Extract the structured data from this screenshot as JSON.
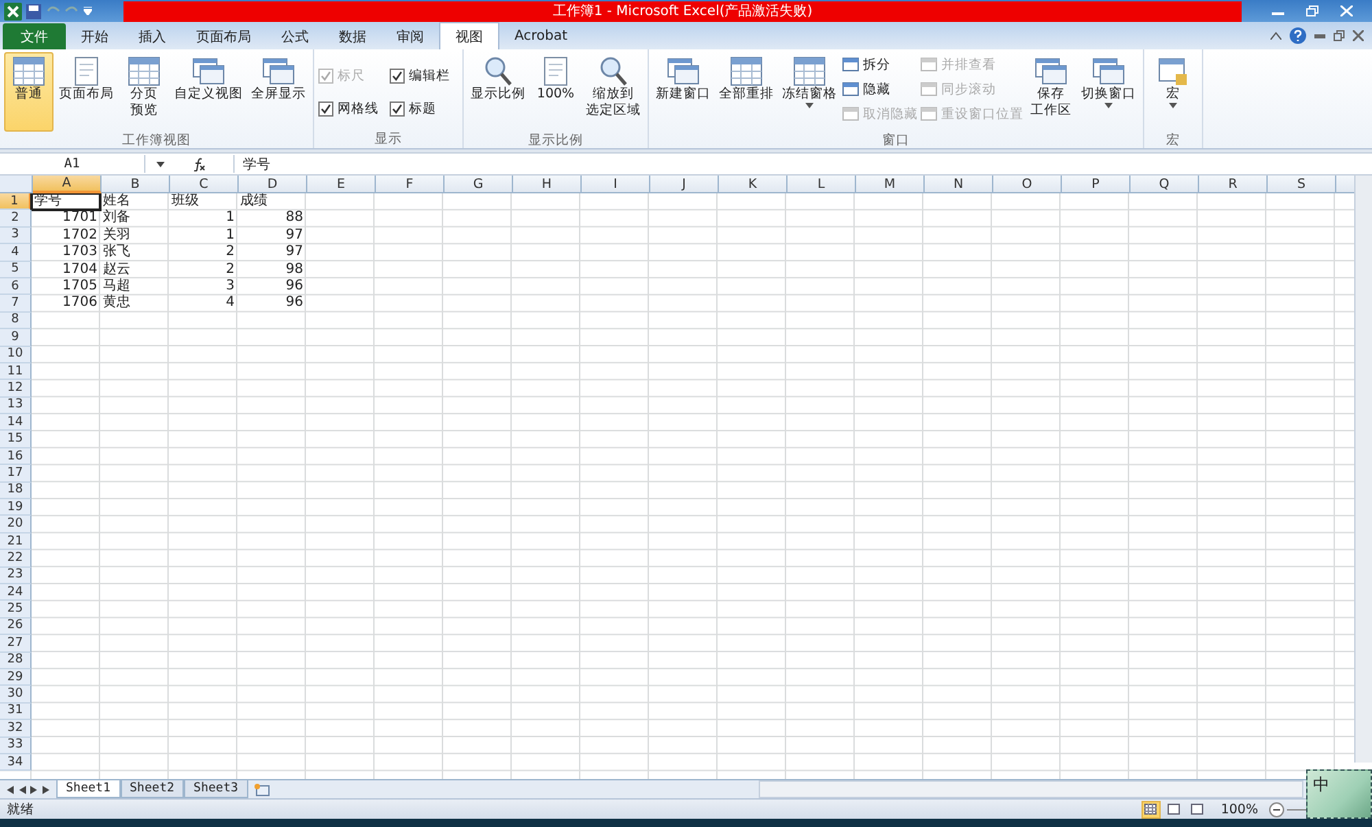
{
  "window": {
    "title": "工作簿1  -  Microsoft Excel(产品激活失败)"
  },
  "ribbon_tabs": [
    {
      "label": "文件",
      "kind": "file",
      "selected": false
    },
    {
      "label": "开始",
      "kind": "tab",
      "selected": false
    },
    {
      "label": "插入",
      "kind": "tab",
      "selected": false
    },
    {
      "label": "页面布局",
      "kind": "tab",
      "selected": false
    },
    {
      "label": "公式",
      "kind": "tab",
      "selected": false
    },
    {
      "label": "数据",
      "kind": "tab",
      "selected": false
    },
    {
      "label": "审阅",
      "kind": "tab",
      "selected": false
    },
    {
      "label": "视图",
      "kind": "tab",
      "selected": true
    },
    {
      "label": "Acrobat",
      "kind": "tab",
      "selected": false
    }
  ],
  "ribbon_groups": [
    {
      "label": "工作簿视图",
      "columns": [
        [
          {
            "kind": "large",
            "label": "普通",
            "selected": true
          }
        ],
        [
          {
            "kind": "large",
            "label": "页面布局",
            "selected": false
          }
        ],
        [
          {
            "kind": "large",
            "label": [
              "分页",
              "预览"
            ],
            "selected": false
          }
        ],
        [
          {
            "kind": "large",
            "label": "自定义视图",
            "selected": false
          }
        ],
        [
          {
            "kind": "large",
            "label": "全屏显示",
            "selected": false
          }
        ]
      ]
    },
    {
      "label": "显示",
      "columns": [
        [
          {
            "kind": "check",
            "label": "标尺",
            "checked": true,
            "disabled": true
          },
          {
            "kind": "check",
            "label": "网格线",
            "checked": true,
            "disabled": false
          }
        ],
        [
          {
            "kind": "check",
            "label": "编辑栏",
            "checked": true,
            "disabled": false
          },
          {
            "kind": "check",
            "label": "标题",
            "checked": true,
            "disabled": false
          }
        ]
      ]
    },
    {
      "label": "显示比例",
      "columns": [
        [
          {
            "kind": "large",
            "label": "显示比例",
            "selected": false
          }
        ],
        [
          {
            "kind": "large",
            "label": "100%",
            "selected": false
          }
        ],
        [
          {
            "kind": "large",
            "label": [
              "缩放到",
              "选定区域"
            ],
            "selected": false
          }
        ]
      ]
    },
    {
      "label": "窗口",
      "columns": [
        [
          {
            "kind": "large",
            "label": "新建窗口",
            "selected": false
          }
        ],
        [
          {
            "kind": "large",
            "label": "全部重排",
            "selected": false
          }
        ],
        [
          {
            "kind": "large",
            "label": "冻结窗格",
            "selected": false,
            "dropdown": true
          }
        ],
        [
          {
            "kind": "small",
            "label": "拆分",
            "disabled": false
          },
          {
            "kind": "small",
            "label": "隐藏",
            "disabled": false
          },
          {
            "kind": "small",
            "label": "取消隐藏",
            "disabled": true
          }
        ],
        [
          {
            "kind": "small",
            "label": "并排查看",
            "disabled": true
          },
          {
            "kind": "small",
            "label": "同步滚动",
            "disabled": true
          },
          {
            "kind": "small",
            "label": "重设窗口位置",
            "disabled": true
          }
        ],
        [
          {
            "kind": "large",
            "label": [
              "保存",
              "工作区"
            ],
            "selected": false
          }
        ],
        [
          {
            "kind": "large",
            "label": "切换窗口",
            "selected": false,
            "dropdown": true
          }
        ]
      ]
    },
    {
      "label": "宏",
      "columns": [
        [
          {
            "kind": "large",
            "label": "宏",
            "selected": false,
            "dropdown": true
          }
        ]
      ]
    }
  ],
  "formula_bar": {
    "name_box": "A1",
    "formula": "学号"
  },
  "columns": [
    {
      "label": "A",
      "selected": true
    },
    {
      "label": "B",
      "selected": false
    },
    {
      "label": "C",
      "selected": false
    },
    {
      "label": "D",
      "selected": false
    },
    {
      "label": "E",
      "selected": false
    },
    {
      "label": "F",
      "selected": false
    },
    {
      "label": "G",
      "selected": false
    },
    {
      "label": "H",
      "selected": false
    },
    {
      "label": "I",
      "selected": false
    },
    {
      "label": "J",
      "selected": false
    },
    {
      "label": "K",
      "selected": false
    },
    {
      "label": "L",
      "selected": false
    },
    {
      "label": "M",
      "selected": false
    },
    {
      "label": "N",
      "selected": false
    },
    {
      "label": "O",
      "selected": false
    },
    {
      "label": "P",
      "selected": false
    },
    {
      "label": "Q",
      "selected": false
    },
    {
      "label": "R",
      "selected": false
    },
    {
      "label": "S",
      "selected": false
    }
  ],
  "rows": [
    {
      "label": "1",
      "selected": true,
      "cells": [
        {
          "text": "学号",
          "kind": "text",
          "selected": true
        },
        {
          "text": "姓名",
          "kind": "text",
          "selected": false
        },
        {
          "text": "班级",
          "kind": "text",
          "selected": false
        },
        {
          "text": "成绩",
          "kind": "text",
          "selected": false
        }
      ]
    },
    {
      "label": "2",
      "selected": false,
      "cells": [
        {
          "text": "1701",
          "kind": "number",
          "selected": false
        },
        {
          "text": "刘备",
          "kind": "text",
          "selected": false
        },
        {
          "text": "1",
          "kind": "number",
          "selected": false
        },
        {
          "text": "88",
          "kind": "number",
          "selected": false
        }
      ]
    },
    {
      "label": "3",
      "selected": false,
      "cells": [
        {
          "text": "1702",
          "kind": "number",
          "selected": false
        },
        {
          "text": "关羽",
          "kind": "text",
          "selected": false
        },
        {
          "text": "1",
          "kind": "number",
          "selected": false
        },
        {
          "text": "97",
          "kind": "number",
          "selected": false
        }
      ]
    },
    {
      "label": "4",
      "selected": false,
      "cells": [
        {
          "text": "1703",
          "kind": "number",
          "selected": false
        },
        {
          "text": "张飞",
          "kind": "text",
          "selected": false
        },
        {
          "text": "2",
          "kind": "number",
          "selected": false
        },
        {
          "text": "97",
          "kind": "number",
          "selected": false
        }
      ]
    },
    {
      "label": "5",
      "selected": false,
      "cells": [
        {
          "text": "1704",
          "kind": "number",
          "selected": false
        },
        {
          "text": "赵云",
          "kind": "text",
          "selected": false
        },
        {
          "text": "2",
          "kind": "number",
          "selected": false
        },
        {
          "text": "98",
          "kind": "number",
          "selected": false
        }
      ]
    },
    {
      "label": "6",
      "selected": false,
      "cells": [
        {
          "text": "1705",
          "kind": "number",
          "selected": false
        },
        {
          "text": "马超",
          "kind": "text",
          "selected": false
        },
        {
          "text": "3",
          "kind": "number",
          "selected": false
        },
        {
          "text": "96",
          "kind": "number",
          "selected": false
        }
      ]
    },
    {
      "label": "7",
      "selected": false,
      "cells": [
        {
          "text": "1706",
          "kind": "number",
          "selected": false
        },
        {
          "text": "黄忠",
          "kind": "text",
          "selected": false
        },
        {
          "text": "4",
          "kind": "number",
          "selected": false
        },
        {
          "text": "96",
          "kind": "number",
          "selected": false
        }
      ]
    },
    {
      "label": "8",
      "selected": false
    },
    {
      "label": "9",
      "selected": false
    },
    {
      "label": "10",
      "selected": false
    },
    {
      "label": "11",
      "selected": false
    },
    {
      "label": "12",
      "selected": false
    },
    {
      "label": "13",
      "selected": false
    },
    {
      "label": "14",
      "selected": false
    },
    {
      "label": "15",
      "selected": false
    },
    {
      "label": "16",
      "selected": false
    },
    {
      "label": "17",
      "selected": false
    },
    {
      "label": "18",
      "selected": false
    },
    {
      "label": "19",
      "selected": false
    },
    {
      "label": "20",
      "selected": false
    },
    {
      "label": "21",
      "selected": false
    },
    {
      "label": "22",
      "selected": false
    },
    {
      "label": "23",
      "selected": false
    },
    {
      "label": "24",
      "selected": false
    },
    {
      "label": "25",
      "selected": false
    },
    {
      "label": "26",
      "selected": false
    },
    {
      "label": "27",
      "selected": false
    },
    {
      "label": "28",
      "selected": false
    },
    {
      "label": "29",
      "selected": false
    },
    {
      "label": "30",
      "selected": false
    },
    {
      "label": "31",
      "selected": false
    },
    {
      "label": "32",
      "selected": false
    },
    {
      "label": "33",
      "selected": false
    },
    {
      "label": "34",
      "selected": false
    }
  ],
  "sheets": [
    {
      "label": "Sheet1",
      "selected": true
    },
    {
      "label": "Sheet2",
      "selected": false
    },
    {
      "label": "Sheet3",
      "selected": false
    }
  ],
  "status_bar": {
    "status": "就绪",
    "views": [
      {
        "selected": true
      },
      {
        "selected": false
      },
      {
        "selected": false
      }
    ],
    "zoom": "100%"
  },
  "ime": {
    "label": "中"
  }
}
